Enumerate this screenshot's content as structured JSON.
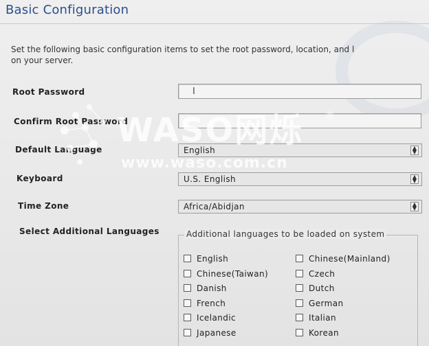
{
  "header": {
    "title": "Basic Configuration"
  },
  "intro": {
    "line1": "Set the following basic configuration items to set the root password, location, and l",
    "line2": "on your server."
  },
  "form": {
    "root_password_label": "Root Password",
    "confirm_password_label": "Confirm Root Password",
    "default_language_label": "Default Language",
    "default_language_value": "English",
    "keyboard_label": "Keyboard",
    "keyboard_value": "U.S. English",
    "timezone_label": "Time Zone",
    "timezone_value": "Africa/Abidjan",
    "additional_languages_label": "Select Additional Languages"
  },
  "additional_languages": {
    "legend": "Additional languages to be loaded on system",
    "left": [
      "English",
      "Chinese(Taiwan)",
      "Danish",
      "French",
      "Icelandic",
      "Japanese"
    ],
    "right": [
      "Chinese(Mainland)",
      "Czech",
      "Dutch",
      "German",
      "Italian",
      "Korean"
    ]
  },
  "watermark": {
    "brand": "WASO网烁",
    "url": "www.waso.com.cn",
    "mark": "®"
  },
  "colors": {
    "title": "#2a4f8c",
    "background": "#ececec"
  }
}
